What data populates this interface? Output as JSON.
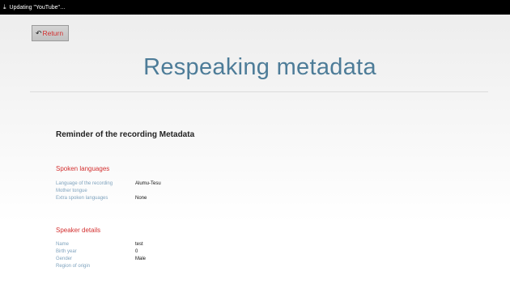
{
  "status_bar": {
    "download_icon": "download-icon",
    "text": "Updating \"YouTube\"…"
  },
  "return_button": {
    "icon": "undo-arrow-icon",
    "label": "Return"
  },
  "page_title": "Respeaking metadata",
  "reminder_title": "Reminder of the recording Metadata",
  "spoken_languages": {
    "title": "Spoken languages",
    "rows": [
      {
        "label": "Language of the recording",
        "value": "Alumu-Tesu"
      },
      {
        "label": "Mother tongue",
        "value": ""
      },
      {
        "label": "Extra spoken languages",
        "value": "None"
      }
    ]
  },
  "speaker_details": {
    "title": "Speaker details",
    "rows": [
      {
        "label": "Name",
        "value": "test"
      },
      {
        "label": "Birth year",
        "value": "0"
      },
      {
        "label": "Gender",
        "value": "Male"
      },
      {
        "label": "Region of origin",
        "value": ""
      }
    ]
  },
  "colors": {
    "title": "#4d7c98",
    "accent_red": "#d32f2f",
    "label_blue": "#7fa3be"
  }
}
